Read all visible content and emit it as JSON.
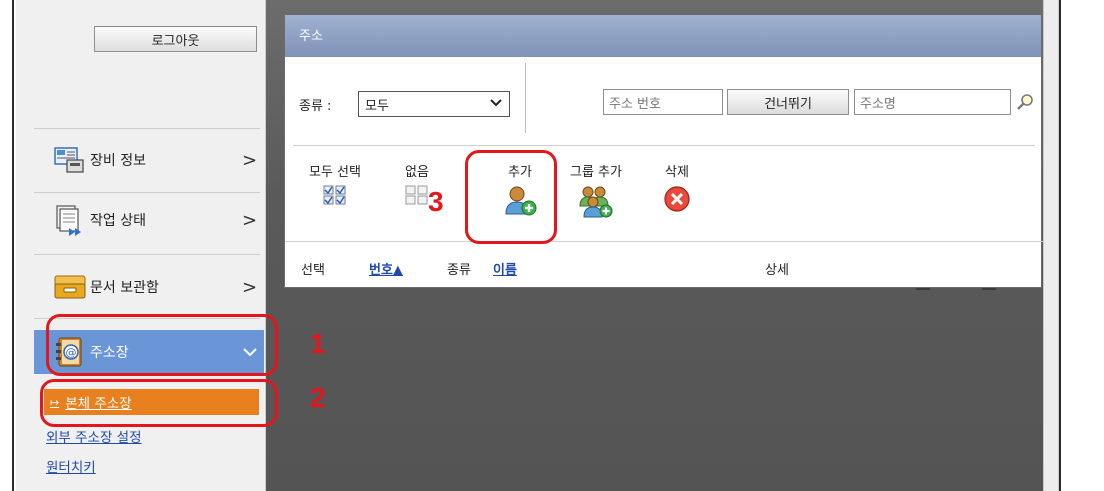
{
  "sidebar": {
    "logout_label": "로그아웃",
    "items": [
      {
        "label": "장비 정보",
        "icon": "device-info-icon"
      },
      {
        "label": "작업 상태",
        "icon": "job-status-icon"
      },
      {
        "label": "문서 보관함",
        "icon": "document-box-icon"
      },
      {
        "label": "주소장",
        "icon": "address-book-icon"
      }
    ],
    "subitems": [
      {
        "label": "본체 주소장"
      },
      {
        "label": "외부 주소장 설정"
      },
      {
        "label": "원터치키"
      }
    ]
  },
  "panel": {
    "title": "주소",
    "type_label": "종류 :",
    "type_select_value": "모두",
    "address_number_placeholder": "주소 번호",
    "skip_label": "건너뛰기",
    "address_name_placeholder": "주소명"
  },
  "toolbar": {
    "select_all_label": "모두 선택",
    "none_label": "없음",
    "add_label": "추가",
    "add_group_label": "그룹 추가",
    "delete_label": "삭제"
  },
  "list_header": {
    "select_label": "선택",
    "number_label": "번호▲",
    "type_label": "종류",
    "name_label": "이름",
    "detail_label": "상세"
  },
  "callouts": {
    "one": "1",
    "two": "2",
    "three": "3"
  },
  "colors": {
    "callout_red": "#e3161c",
    "active_sidebar": "#6a96d8",
    "active_subitem": "#e8801f",
    "link_blue": "#1f4aa8"
  }
}
